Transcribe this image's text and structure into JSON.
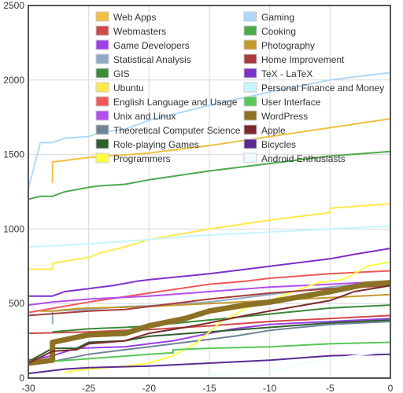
{
  "chart_data": {
    "type": "line",
    "title": "",
    "xlabel": "",
    "ylabel": "",
    "xlim": [
      -30,
      0
    ],
    "ylim": [
      0,
      2500
    ],
    "x_ticks": [
      -30,
      -25,
      -20,
      -15,
      -10,
      -5,
      0
    ],
    "y_ticks": [
      0,
      500,
      1000,
      1500,
      2000,
      2500
    ],
    "grid": true,
    "legend_position": "top-center, two columns",
    "series": [
      {
        "name": "Web Apps",
        "color": "#f0c040",
        "points": [
          [
            -28,
            1310
          ],
          [
            -28,
            1450
          ],
          [
            -25,
            1480
          ],
          [
            -20,
            1510
          ],
          [
            -15,
            1560
          ],
          [
            -10,
            1620
          ],
          [
            -5,
            1680
          ],
          [
            0,
            1740
          ]
        ]
      },
      {
        "name": "Webmasters",
        "color": "#d04848",
        "points": [
          [
            -30,
            300
          ],
          [
            -25,
            310
          ],
          [
            -22,
            320
          ],
          [
            -20,
            325
          ],
          [
            -15,
            350
          ],
          [
            -10,
            380
          ],
          [
            -5,
            400
          ],
          [
            0,
            420
          ]
        ]
      },
      {
        "name": "Game Developers",
        "color": "#9b3fe8",
        "points": [
          [
            -30,
            120
          ],
          [
            -28,
            150
          ],
          [
            -26,
            200
          ],
          [
            -22,
            210
          ],
          [
            -20,
            230
          ],
          [
            -18,
            250
          ],
          [
            -15,
            300
          ],
          [
            -13,
            330
          ],
          [
            -10,
            360
          ],
          [
            -5,
            380
          ],
          [
            0,
            400
          ]
        ]
      },
      {
        "name": "Statistical Analysis",
        "color": "#8fabc8",
        "points": [
          [
            -28,
            360
          ],
          [
            -28,
            450
          ],
          [
            -25,
            460
          ],
          [
            -22,
            480
          ],
          [
            -20,
            485
          ],
          [
            -15,
            510
          ],
          [
            -10,
            560
          ],
          [
            -5,
            610
          ],
          [
            0,
            650
          ]
        ]
      },
      {
        "name": "GIS",
        "color": "#3a8a3a",
        "points": [
          [
            -28,
            310
          ],
          [
            -25,
            330
          ],
          [
            -22,
            340
          ],
          [
            -20,
            350
          ],
          [
            -15,
            390
          ],
          [
            -10,
            430
          ],
          [
            -5,
            470
          ],
          [
            0,
            490
          ]
        ]
      },
      {
        "name": "Ubuntu",
        "color": "#ffe84a",
        "points": [
          [
            -30,
            730
          ],
          [
            -28,
            730
          ],
          [
            -28,
            770
          ],
          [
            -25,
            810
          ],
          [
            -24,
            840
          ],
          [
            -22,
            880
          ],
          [
            -20,
            930
          ],
          [
            -15,
            1000
          ],
          [
            -10,
            1060
          ],
          [
            -5,
            1110
          ],
          [
            -5,
            1140
          ],
          [
            0,
            1170
          ]
        ]
      },
      {
        "name": "English Language and Usage",
        "color": "#f05858",
        "points": [
          [
            -30,
            300
          ],
          [
            -30,
            440
          ],
          [
            -25,
            510
          ],
          [
            -20,
            570
          ],
          [
            -15,
            630
          ],
          [
            -12,
            650
          ],
          [
            -10,
            670
          ],
          [
            -5,
            700
          ],
          [
            0,
            720
          ]
        ]
      },
      {
        "name": "Unix and Linux",
        "color": "#b44ef0",
        "points": [
          [
            -30,
            490
          ],
          [
            -28,
            510
          ],
          [
            -25,
            530
          ],
          [
            -20,
            550
          ],
          [
            -15,
            580
          ],
          [
            -10,
            610
          ],
          [
            -5,
            630
          ],
          [
            0,
            650
          ]
        ]
      },
      {
        "name": "Theoretical Computer Science",
        "color": "#6e8498",
        "points": [
          [
            -30,
            90
          ],
          [
            -28,
            110
          ],
          [
            -25,
            160
          ],
          [
            -22,
            190
          ],
          [
            -20,
            210
          ],
          [
            -15,
            260
          ],
          [
            -13,
            280
          ],
          [
            -10,
            320
          ],
          [
            -5,
            360
          ],
          [
            0,
            380
          ]
        ]
      },
      {
        "name": "Role-playing Games",
        "color": "#2d5f2d",
        "points": [
          [
            -30,
            110
          ],
          [
            -28,
            200
          ],
          [
            -26,
            200
          ],
          [
            -25,
            240
          ],
          [
            -22,
            250
          ],
          [
            -20,
            280
          ],
          [
            -15,
            310
          ],
          [
            -10,
            340
          ],
          [
            -5,
            370
          ],
          [
            0,
            390
          ]
        ]
      },
      {
        "name": "Programmers",
        "color": "#ffff44",
        "points": [
          [
            -27,
            40
          ],
          [
            -25,
            60
          ],
          [
            -22,
            80
          ],
          [
            -20,
            100
          ],
          [
            -18,
            150
          ],
          [
            -16,
            240
          ],
          [
            -14,
            380
          ],
          [
            -13,
            420
          ],
          [
            -12,
            470
          ],
          [
            -10,
            520
          ],
          [
            -8,
            580
          ],
          [
            -6,
            640
          ],
          [
            -4,
            660
          ],
          [
            -3,
            700
          ],
          [
            -2,
            750
          ],
          [
            0,
            780
          ]
        ]
      },
      {
        "name": "Gaming",
        "color": "#b0d8f8",
        "points": [
          [
            -30,
            1270
          ],
          [
            -29,
            1580
          ],
          [
            -28,
            1580
          ],
          [
            -27,
            1610
          ],
          [
            -25,
            1620
          ],
          [
            -24,
            1650
          ],
          [
            -22,
            1670
          ],
          [
            -20,
            1730
          ],
          [
            -15,
            1830
          ],
          [
            -10,
            1920
          ],
          [
            -5,
            2000
          ],
          [
            0,
            2050
          ]
        ]
      },
      {
        "name": "Cooking",
        "color": "#4caa4c",
        "points": [
          [
            -30,
            1010
          ],
          [
            -30,
            1200
          ],
          [
            -29,
            1220
          ],
          [
            -28,
            1220
          ],
          [
            -27,
            1250
          ],
          [
            -25,
            1280
          ],
          [
            -24,
            1290
          ],
          [
            -22,
            1300
          ],
          [
            -20,
            1330
          ],
          [
            -15,
            1390
          ],
          [
            -10,
            1440
          ],
          [
            -5,
            1490
          ],
          [
            0,
            1520
          ]
        ]
      },
      {
        "name": "Photography",
        "color": "#c49a2c",
        "points": [
          [
            -29,
            450
          ],
          [
            -28,
            450
          ],
          [
            -26,
            465
          ],
          [
            -25,
            470
          ],
          [
            -22,
            475
          ],
          [
            -20,
            480
          ],
          [
            -15,
            500
          ],
          [
            -10,
            520
          ],
          [
            -5,
            540
          ],
          [
            0,
            560
          ]
        ]
      },
      {
        "name": "Home Improvement",
        "color": "#a83c3c",
        "points": [
          [
            -30,
            420
          ],
          [
            -25,
            450
          ],
          [
            -22,
            460
          ],
          [
            -20,
            480
          ],
          [
            -15,
            530
          ],
          [
            -10,
            570
          ],
          [
            -5,
            600
          ],
          [
            0,
            620
          ]
        ]
      },
      {
        "name": "TeX - LaTeX",
        "color": "#7d30c8",
        "points": [
          [
            -30,
            440
          ],
          [
            -30,
            550
          ],
          [
            -28,
            550
          ],
          [
            -27,
            580
          ],
          [
            -25,
            600
          ],
          [
            -23,
            620
          ],
          [
            -21,
            650
          ],
          [
            -20,
            660
          ],
          [
            -15,
            700
          ],
          [
            -12,
            730
          ],
          [
            -10,
            750
          ],
          [
            -5,
            800
          ],
          [
            -3,
            830
          ],
          [
            0,
            870
          ]
        ]
      },
      {
        "name": "Personal Finance and Money",
        "color": "#c8f4fc",
        "points": [
          [
            -30,
            880
          ],
          [
            -25,
            900
          ],
          [
            -20,
            930
          ],
          [
            -17,
            950
          ],
          [
            -15,
            960
          ],
          [
            -10,
            980
          ],
          [
            -5,
            1000
          ],
          [
            0,
            1020
          ]
        ]
      },
      {
        "name": "User Interface",
        "color": "#58c858",
        "points": [
          [
            -30,
            100
          ],
          [
            -25,
            130
          ],
          [
            -20,
            160
          ],
          [
            -18,
            170
          ],
          [
            -18,
            190
          ],
          [
            -15,
            200
          ],
          [
            -10,
            210
          ],
          [
            -5,
            230
          ],
          [
            0,
            240
          ]
        ]
      },
      {
        "name": "WordPress",
        "color": "#8b7224",
        "points": [
          [
            -30,
            100
          ],
          [
            -28,
            120
          ],
          [
            -28,
            240
          ],
          [
            -25,
            290
          ],
          [
            -22,
            300
          ],
          [
            -20,
            350
          ],
          [
            -17,
            400
          ],
          [
            -15,
            450
          ],
          [
            -12,
            490
          ],
          [
            -10,
            510
          ],
          [
            -5,
            580
          ],
          [
            -2,
            630
          ],
          [
            0,
            640
          ]
        ]
      },
      {
        "name": "Apple",
        "color": "#7a2a2a",
        "points": [
          [
            -30,
            100
          ],
          [
            -28,
            180
          ],
          [
            -26,
            190
          ],
          [
            -25,
            230
          ],
          [
            -22,
            250
          ],
          [
            -20,
            300
          ],
          [
            -17,
            340
          ],
          [
            -15,
            370
          ],
          [
            -12,
            420
          ],
          [
            -10,
            450
          ],
          [
            -5,
            520
          ],
          [
            -3,
            580
          ],
          [
            0,
            620
          ]
        ]
      },
      {
        "name": "Bicycles",
        "color": "#5a2a90",
        "points": [
          [
            -30,
            30
          ],
          [
            -27,
            60
          ],
          [
            -25,
            70
          ],
          [
            -20,
            80
          ],
          [
            -15,
            100
          ],
          [
            -10,
            120
          ],
          [
            -5,
            150
          ],
          [
            0,
            160
          ]
        ]
      },
      {
        "name": "Android Enthusiasts",
        "color": "#eefcfc",
        "points": [
          [
            -15,
            20
          ],
          [
            -12,
            40
          ],
          [
            -9,
            60
          ],
          [
            -7,
            100
          ],
          [
            -5,
            130
          ],
          [
            -3,
            150
          ],
          [
            0,
            180
          ]
        ]
      }
    ]
  }
}
